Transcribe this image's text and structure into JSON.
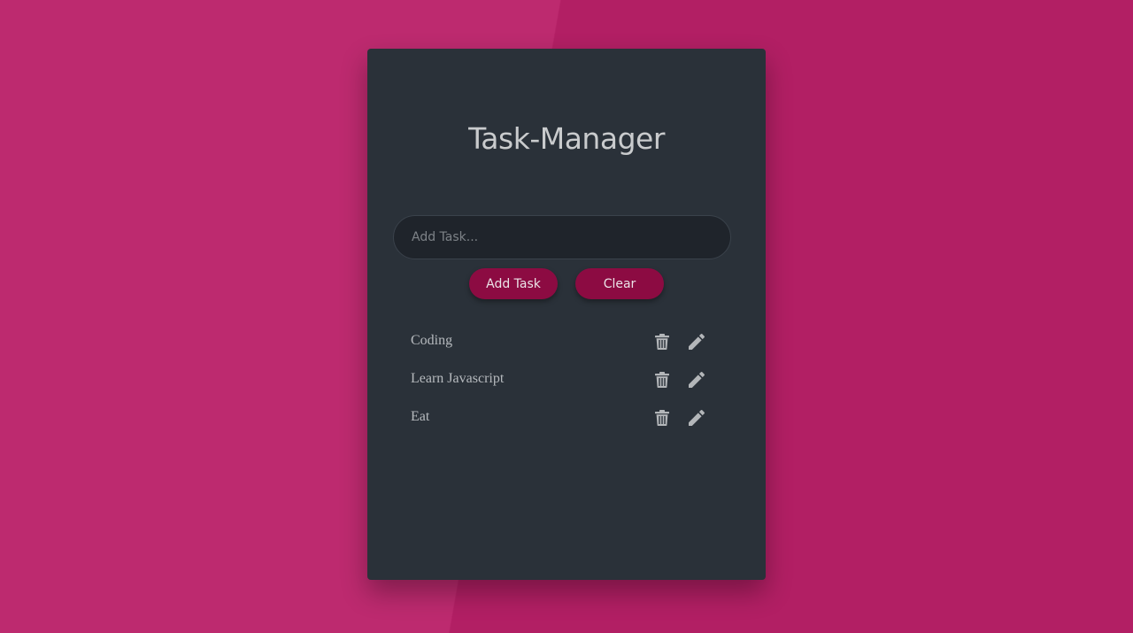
{
  "app": {
    "title": "Task-Manager"
  },
  "input": {
    "placeholder": "Add Task...",
    "value": ""
  },
  "buttons": {
    "add_label": "Add Task",
    "clear_label": "Clear"
  },
  "tasks": [
    {
      "label": "Coding",
      "actions": [
        "trash-icon",
        "pencil-icon"
      ]
    },
    {
      "label": "Learn Javascript",
      "actions": [
        "trash-icon",
        "pencil-icon"
      ]
    },
    {
      "label": "Eat",
      "actions": [
        "trash-icon",
        "pencil-icon"
      ]
    }
  ],
  "colors": {
    "background": "#b21f64",
    "card": "#2a3139",
    "input": "#1f242b",
    "button": "#8c0b42",
    "text": "#c9cbcd",
    "icon": "#b3b6b9"
  }
}
